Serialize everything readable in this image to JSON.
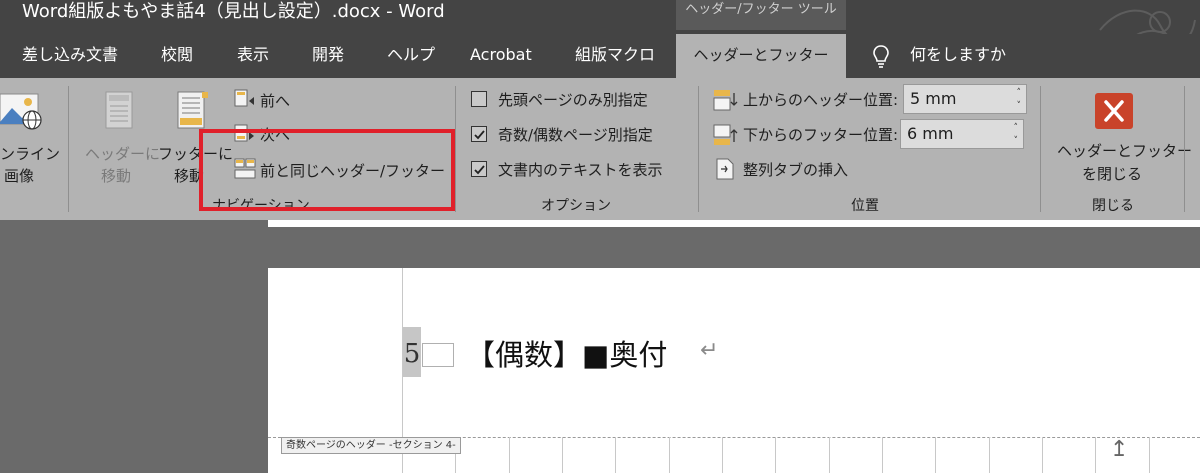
{
  "window": {
    "title": "Word組版よもやま話4（見出し設定）.docx  -  Word",
    "context_tab_label": "ヘッダー/フッター ツール"
  },
  "tabs": [
    {
      "label": "差し込み文書"
    },
    {
      "label": "校閲"
    },
    {
      "label": "表示"
    },
    {
      "label": "開発"
    },
    {
      "label": "ヘルプ"
    },
    {
      "label": "Acrobat"
    },
    {
      "label": "組版マクロ"
    },
    {
      "label": "ヘッダーとフッター",
      "active": true
    }
  ],
  "tell_me": "何をしますか",
  "ribbon": {
    "online_picture": {
      "line1": "ンライン",
      "line2": "画像"
    },
    "navigation": {
      "goto_header": {
        "line1": "ヘッダーに",
        "line2": "移動",
        "enabled": false
      },
      "goto_footer": {
        "line1": "フッターに",
        "line2": "移動",
        "enabled": true
      },
      "previous": "前へ",
      "next": "次へ",
      "link_to_previous": "前と同じヘッダー/フッター",
      "group_label": "ナビゲーション"
    },
    "options": {
      "different_first_page": {
        "label": "先頭ページのみ別指定",
        "checked": false
      },
      "different_odd_even": {
        "label": "奇数/偶数ページ別指定",
        "checked": true
      },
      "show_document_text": {
        "label": "文書内のテキストを表示",
        "checked": true
      },
      "group_label": "オプション"
    },
    "position": {
      "header_from_top": {
        "label": "上からのヘッダー位置:",
        "value": "5 mm"
      },
      "footer_from_bottom": {
        "label": "下からのフッター位置:",
        "value": "6 mm"
      },
      "insert_alignment_tab": "整列タブの挿入",
      "group_label": "位置"
    },
    "close": {
      "line1": "ヘッダーとフッター",
      "line2": "を閉じる",
      "group_label": "閉じる"
    }
  },
  "document": {
    "page_number": "5",
    "header_text": "【偶数】■奥付",
    "paragraph_mark": "↵",
    "header_label": "奇数ページのヘッダー -セクション 4-",
    "up_arrow": "↥"
  },
  "colors": {
    "titlebar": "#444444",
    "ribbon": "#b3b3b3",
    "highlight_box": "#e0202a",
    "close_icon": "#c9432a"
  }
}
